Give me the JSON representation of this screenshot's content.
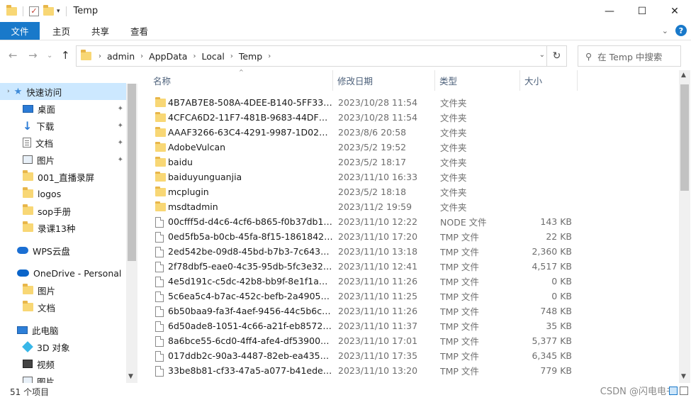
{
  "window": {
    "title": "Temp",
    "minimize_glyph": "—",
    "maximize_glyph": "☐",
    "close_glyph": "✕"
  },
  "quick_access": {
    "check_glyph": "✓",
    "dropdown_glyph": "▾"
  },
  "ribbon": {
    "tabs": [
      "文件",
      "主页",
      "共享",
      "查看"
    ],
    "collapse_glyph": "⌄",
    "help_glyph": "?"
  },
  "nav": {
    "back_glyph": "←",
    "forward_glyph": "→",
    "recent_glyph": "⌄",
    "up_glyph": "↑",
    "breadcrumbs": [
      "admin",
      "AppData",
      "Local",
      "Temp"
    ],
    "crumb_sep": "›",
    "dropdown_glyph": "⌄",
    "refresh_glyph": "↻",
    "search_placeholder": "在 Temp 中搜索",
    "search_glyph": "⚲"
  },
  "sidebar": {
    "items": [
      {
        "label": "快速访问",
        "icon": "star-icon"
      },
      {
        "label": "桌面",
        "icon": "desktop-icon",
        "pinned": true
      },
      {
        "label": "下载",
        "icon": "download-icon",
        "pinned": true
      },
      {
        "label": "文档",
        "icon": "document-icon",
        "pinned": true
      },
      {
        "label": "图片",
        "icon": "pictures-icon",
        "pinned": true
      },
      {
        "label": "001_直播录屏",
        "icon": "folder-icon"
      },
      {
        "label": "logos",
        "icon": "folder-icon"
      },
      {
        "label": "sop手册",
        "icon": "folder-icon"
      },
      {
        "label": "录课13种",
        "icon": "folder-icon"
      },
      {
        "label": "WPS云盘",
        "icon": "cloud-icon"
      },
      {
        "label": "OneDrive - Personal",
        "icon": "onedrive-icon"
      },
      {
        "label": "图片",
        "icon": "folder-icon"
      },
      {
        "label": "文档",
        "icon": "folder-icon"
      },
      {
        "label": "此电脑",
        "icon": "computer-icon"
      },
      {
        "label": "3D 对象",
        "icon": "3d-objects-icon"
      },
      {
        "label": "视频",
        "icon": "video-icon"
      },
      {
        "label": "图片",
        "icon": "pictures-icon"
      }
    ],
    "pin_glyph": "📌",
    "expand_glyph": "›",
    "scroll_up_glyph": "▲",
    "scroll_down_glyph": "▼"
  },
  "columns": {
    "name": "名称",
    "date": "修改日期",
    "type": "类型",
    "size": "大小",
    "sort_glyph": "^"
  },
  "files": [
    {
      "name": "4B7AB7E8-508A-4DEE-B140-5FF33F2...",
      "date": "2023/10/28 11:54",
      "type": "文件夹",
      "size": "",
      "kind": "folder"
    },
    {
      "name": "4CFCA6D2-11F7-481B-9683-44DF0BA...",
      "date": "2023/10/28 11:54",
      "type": "文件夹",
      "size": "",
      "kind": "folder"
    },
    {
      "name": "AAAF3266-63C4-4291-9987-1D021A6...",
      "date": "2023/8/6 20:58",
      "type": "文件夹",
      "size": "",
      "kind": "folder"
    },
    {
      "name": "AdobeVulcan",
      "date": "2023/5/2 19:52",
      "type": "文件夹",
      "size": "",
      "kind": "folder"
    },
    {
      "name": "baidu",
      "date": "2023/5/2 18:17",
      "type": "文件夹",
      "size": "",
      "kind": "folder"
    },
    {
      "name": "baiduyunguanjia",
      "date": "2023/11/10 16:33",
      "type": "文件夹",
      "size": "",
      "kind": "folder"
    },
    {
      "name": "mcplugin",
      "date": "2023/5/2 18:18",
      "type": "文件夹",
      "size": "",
      "kind": "folder"
    },
    {
      "name": "msdtadmin",
      "date": "2023/11/2 19:59",
      "type": "文件夹",
      "size": "",
      "kind": "folder"
    },
    {
      "name": "00cfff5d-d4c6-4cf6-b865-f0b37db19...",
      "date": "2023/11/10 12:22",
      "type": "NODE 文件",
      "size": "143 KB",
      "kind": "file"
    },
    {
      "name": "0ed5fb5a-b0cb-45fa-8f15-18618423e...",
      "date": "2023/11/10 17:20",
      "type": "TMP 文件",
      "size": "22 KB",
      "kind": "file"
    },
    {
      "name": "2ed542be-09d8-45bd-b7b3-7c6433e...",
      "date": "2023/11/10 13:18",
      "type": "TMP 文件",
      "size": "2,360 KB",
      "kind": "file"
    },
    {
      "name": "2f78dbf5-eae0-4c35-95db-5fc3e32dc...",
      "date": "2023/11/10 12:41",
      "type": "TMP 文件",
      "size": "4,517 KB",
      "kind": "file"
    },
    {
      "name": "4e5d191c-c5dc-42b8-bb9f-8e1f1a70...",
      "date": "2023/11/10 11:26",
      "type": "TMP 文件",
      "size": "0 KB",
      "kind": "file"
    },
    {
      "name": "5c6ea5c4-b7ac-452c-befb-2a490547...",
      "date": "2023/11/10 11:25",
      "type": "TMP 文件",
      "size": "0 KB",
      "kind": "file"
    },
    {
      "name": "6b50baa9-fa3f-4aef-9456-44c5b6c0c...",
      "date": "2023/11/10 11:26",
      "type": "TMP 文件",
      "size": "748 KB",
      "kind": "file"
    },
    {
      "name": "6d50ade8-1051-4c66-a21f-eb8572d1...",
      "date": "2023/11/10 11:37",
      "type": "TMP 文件",
      "size": "35 KB",
      "kind": "file"
    },
    {
      "name": "8a6bce55-6cd0-4ff4-afe4-df539001c...",
      "date": "2023/11/10 17:01",
      "type": "TMP 文件",
      "size": "5,377 KB",
      "kind": "file"
    },
    {
      "name": "017ddb2c-90a3-4487-82eb-ea43557...",
      "date": "2023/11/10 17:35",
      "type": "TMP 文件",
      "size": "6,345 KB",
      "kind": "file"
    },
    {
      "name": "33be8b81-cf33-47a5-a077-b41ede89...",
      "date": "2023/11/10 13:20",
      "type": "TMP 文件",
      "size": "779 KB",
      "kind": "file"
    }
  ],
  "status": {
    "count": "51 个项目",
    "watermark": "CSDN @闪电电书"
  },
  "scrollbar": {
    "up_glyph": "▲",
    "down_glyph": "▼"
  }
}
